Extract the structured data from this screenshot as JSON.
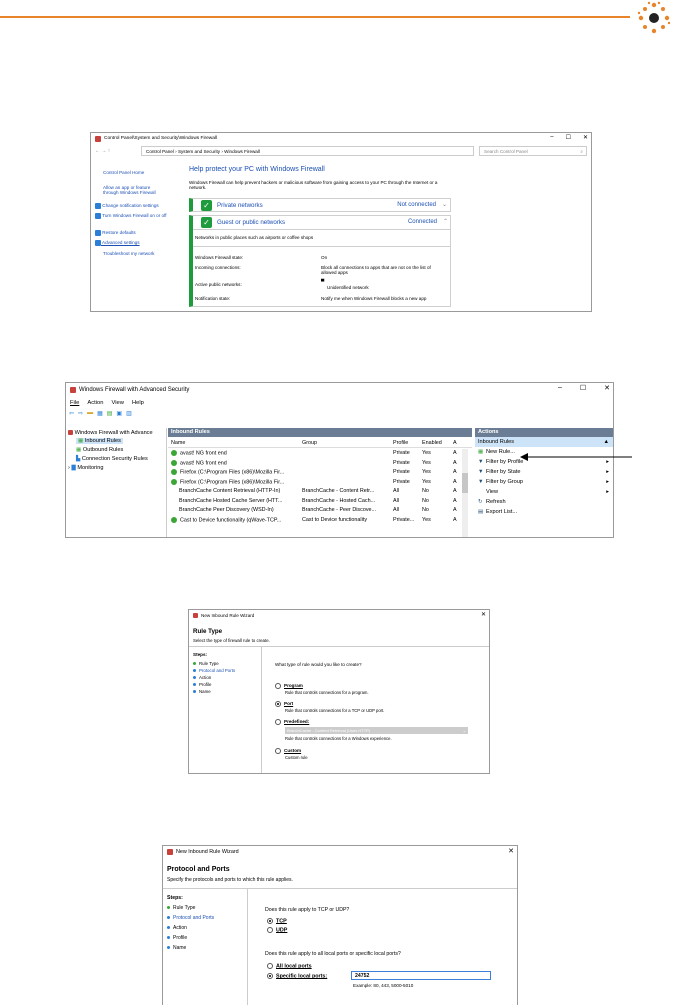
{
  "w1": {
    "title": "Control Panel\\System and Security\\Windows Firewall",
    "breadcrumb": [
      "Control Panel",
      "System and Security",
      "Windows Firewall"
    ],
    "search_placeholder": "Search Control Panel",
    "left_links": [
      "Control Panel Home",
      "Allow an app or feature through Windows Firewall",
      "Change notification settings",
      "Turn Windows Firewall on or off",
      "Restore defaults",
      "Advanced settings",
      "Troubleshoot my network"
    ],
    "heading": "Help protect your PC with Windows Firewall",
    "desc": "Windows Firewall can help prevent hackers or malicious software from gaining access to your PC through the Internet or a network.",
    "private_label": "Private networks",
    "private_status": "Not connected",
    "guest_label": "Guest or public networks",
    "guest_status": "Connected",
    "guest_desc": "Networks in public places such as airports or coffee shops",
    "details": [
      {
        "k": "Windows Firewall state:",
        "v": "On"
      },
      {
        "k": "Incoming connections:",
        "v": "Block all connections to apps that are not on the list of allowed apps"
      },
      {
        "k": "Active public networks:",
        "v": "Unidentified network"
      },
      {
        "k": "Notification state:",
        "v": "Notify me when Windows Firewall blocks a new app"
      }
    ]
  },
  "w2": {
    "title": "Windows Firewall with Advanced Security",
    "menu": [
      "File",
      "Action",
      "View",
      "Help"
    ],
    "tree": [
      "Windows Firewall with Advance",
      "Inbound Rules",
      "Outbound Rules",
      "Connection Security Rules",
      "Monitoring"
    ],
    "header": "Inbound Rules",
    "columns": [
      "Name",
      "Group",
      "Profile",
      "Enabled",
      "A"
    ],
    "rows": [
      {
        "name": "avast! NG front end",
        "group": "",
        "profile": "Private",
        "enabled": "Yes",
        "a": "A"
      },
      {
        "name": "avast! NG front end",
        "group": "",
        "profile": "Private",
        "enabled": "Yes",
        "a": "A"
      },
      {
        "name": "Firefox (C:\\Program Files (x86)\\Mozilla Fir...",
        "group": "",
        "profile": "Private",
        "enabled": "Yes",
        "a": "A"
      },
      {
        "name": "Firefox (C:\\Program Files (x86)\\Mozilla Fir...",
        "group": "",
        "profile": "Private",
        "enabled": "Yes",
        "a": "A"
      },
      {
        "name": "BranchCache Content Retrieval (HTTP-In)",
        "group": "BranchCache - Content Retr...",
        "profile": "All",
        "enabled": "No",
        "a": "A"
      },
      {
        "name": "BranchCache Hosted Cache Server (HTT...",
        "group": "BranchCache - Hosted Cach...",
        "profile": "All",
        "enabled": "No",
        "a": "A"
      },
      {
        "name": "BranchCache Peer Discovery (WSD-In)",
        "group": "BranchCache - Peer Discove...",
        "profile": "All",
        "enabled": "No",
        "a": "A"
      },
      {
        "name": "Cast to Device functionality (qWave-TCP...",
        "group": "Cast to Device functionality",
        "profile": "Private...",
        "enabled": "Yes",
        "a": "A"
      }
    ],
    "actions_header": "Actions",
    "actions_sub": "Inbound Rules",
    "actions": [
      "New Rule...",
      "Filter by Profile",
      "Filter by State",
      "Filter by Group",
      "View",
      "Refresh",
      "Export List..."
    ]
  },
  "w3": {
    "title": "New Inbound Rule Wizard",
    "heading": "Rule Type",
    "sub": "Select the type of firewall rule to create.",
    "steps_label": "Steps:",
    "steps": [
      "Rule Type",
      "Protocol and Ports",
      "Action",
      "Profile",
      "Name"
    ],
    "question": "What type of rule would you like to create?",
    "options": [
      {
        "label": "Program",
        "desc": "Rule that controls connections for a program."
      },
      {
        "label": "Port",
        "desc": "Rule that controls connections for a TCP or UDP port."
      },
      {
        "label": "Predefined:",
        "desc": "Rule that controls connections for a Windows experience."
      },
      {
        "label": "Custom",
        "desc": "Custom rule"
      }
    ],
    "predefined_value": "BranchCache - Content Retrieval (Uses HTTP)"
  },
  "w4": {
    "title": "New Inbound Rule Wizard",
    "heading": "Protocol and Ports",
    "sub": "Specify the protocols and ports to which this rule applies.",
    "steps_label": "Steps:",
    "steps": [
      "Rule Type",
      "Protocol and Ports",
      "Action",
      "Profile",
      "Name"
    ],
    "q1": "Does this rule apply to TCP or UDP?",
    "tcp": "TCP",
    "udp": "UDP",
    "q2": "Does this rule apply to all local ports or specific local ports?",
    "all_ports": "All local ports",
    "specific_ports": "Specific local ports:",
    "port_value": "24752",
    "example": "Example: 80, 443, 5000-5010"
  }
}
